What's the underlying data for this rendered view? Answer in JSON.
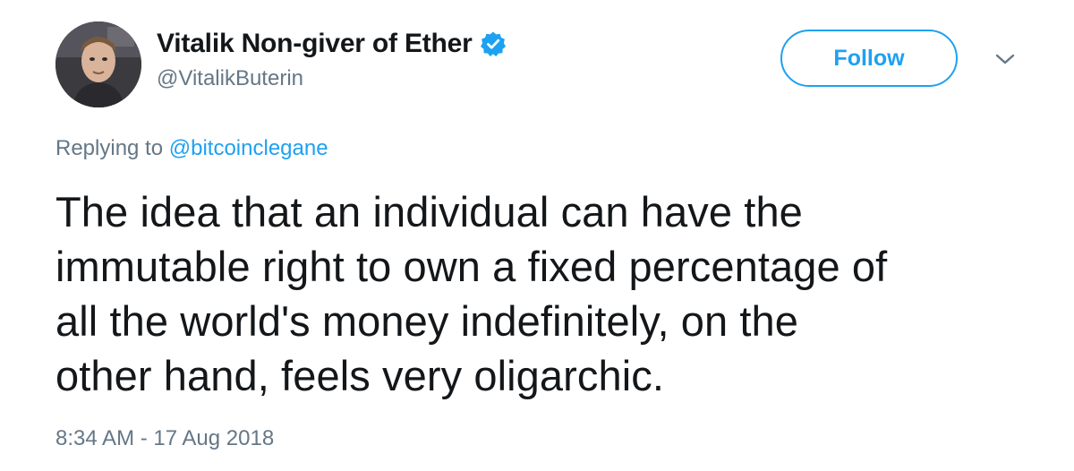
{
  "author": {
    "display_name": "Vitalik Non-giver of Ether",
    "handle": "@VitalikButerin",
    "verified_icon": "verified-badge-icon",
    "avatar": "profile-photo"
  },
  "actions": {
    "follow_label": "Follow",
    "more_icon": "chevron-down-icon"
  },
  "reply": {
    "prefix": "Replying to",
    "mention": "@bitcoinclegane"
  },
  "tweet": {
    "text_lines": [
      "The idea that an individual can have the",
      "immutable right to own a fixed percentage of",
      "all the world's money indefinitely, on the",
      "other hand, feels very oligarchic."
    ],
    "timestamp": "8:34 AM - 17 Aug 2018"
  },
  "colors": {
    "accent": "#1da1f2",
    "text": "#14171a",
    "secondary_text": "#657786"
  }
}
